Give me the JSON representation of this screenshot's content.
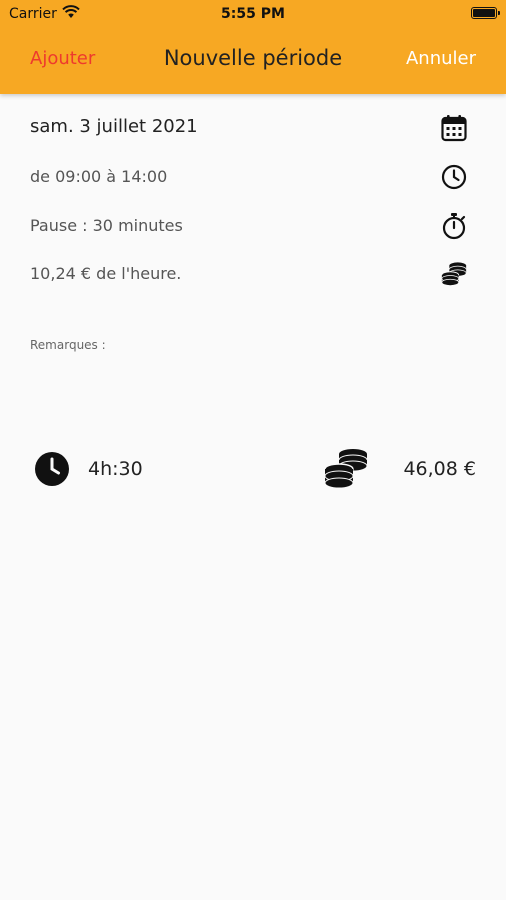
{
  "status_bar": {
    "carrier": "Carrier",
    "time": "5:55 PM"
  },
  "nav": {
    "left_label": "Ajouter",
    "title": "Nouvelle période",
    "right_label": "Annuler",
    "accent_color": "#f7a823",
    "left_color": "#ee3a2d"
  },
  "details": {
    "date": "sam. 3 juillet 2021",
    "hours": "de 09:00 à 14:00",
    "pause": "Pause : 30 minutes",
    "rate": "10,24 € de l'heure."
  },
  "remarks_label": "Remarques :",
  "summary": {
    "duration": "4h:30",
    "amount": "46,08 €"
  },
  "icons": [
    "calendar-icon",
    "clock-icon",
    "stopwatch-icon",
    "coins-icon"
  ]
}
